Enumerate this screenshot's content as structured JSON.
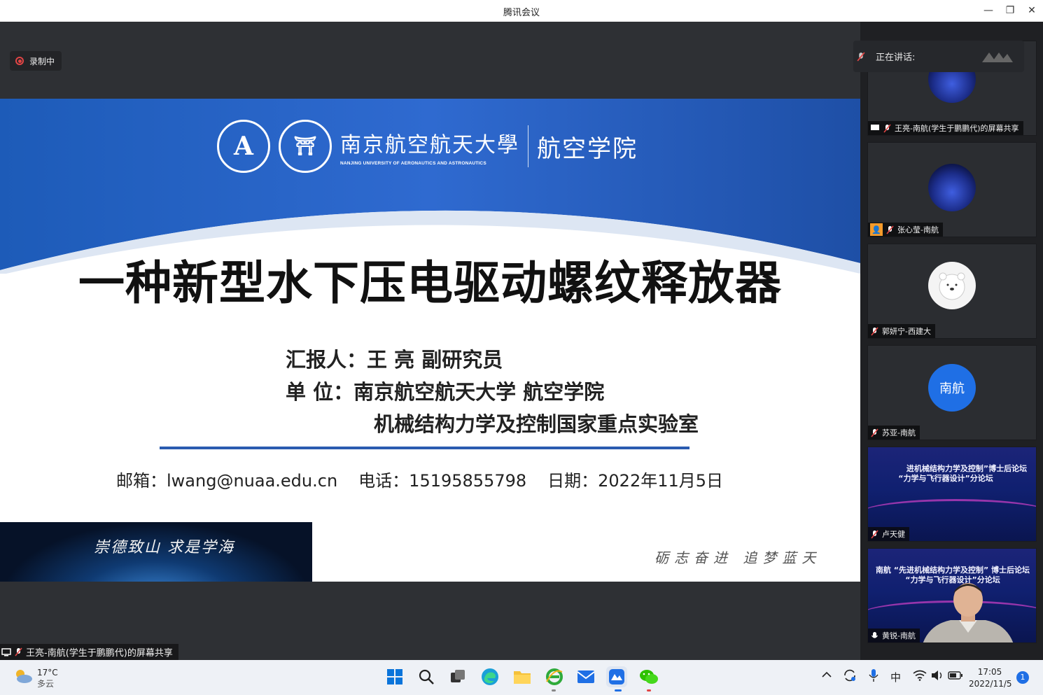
{
  "window": {
    "title": "腾讯会议"
  },
  "recording": {
    "label": "录制中"
  },
  "slide": {
    "university_cn": "南京航空航天大學",
    "university_en": "NANJING UNIVERSITY OF AERONAUTICS AND ASTRONAUTICS",
    "school": "航空学院",
    "title": "一种新型水下压电驱动螺纹释放器",
    "reporter": "汇报人：王  亮  副研究员",
    "unit": "单      位：南京航空航天大学 航空学院",
    "lab": "机械结构力学及控制国家重点实验室",
    "email": "邮箱：lwang@nuaa.edu.cn",
    "phone": "电话：15195855798",
    "date": "日期：2022年11月5日",
    "banner_text": "崇德致山  求是学海",
    "motto": "砺志奋进  追梦蓝天"
  },
  "share_label": "王亮-南航(学生于鹏鹏代)的屏幕共享",
  "speaking": {
    "label": "正在讲话:"
  },
  "participants": [
    {
      "name": "王亮-南航(学生于鹏鹏代)的屏幕共享"
    },
    {
      "name": "张心莹-南航"
    },
    {
      "name": "郭妍宁-西建大"
    },
    {
      "name": "苏亚-南航",
      "avatar_text": "南航"
    },
    {
      "name": "卢天健",
      "poster_line1": "进机械结构力学及控制”博士后论坛",
      "poster_line2": "“力学与飞行器设计”分论坛"
    },
    {
      "name": "黄锐-南航",
      "poster_line1": "南航 “先进机械结构力学及控制” 博士后论坛",
      "poster_line2": "“力学与飞行器设计”分论坛"
    }
  ],
  "taskbar": {
    "weather_temp": "17°C",
    "weather_desc": "多云",
    "ime": "中",
    "time": "17:05",
    "date": "2022/11/5",
    "notification_count": "1"
  },
  "colors": {
    "slide_blue": "#2a5bb0",
    "accent": "#1f6fe5",
    "record_red": "#e14545"
  }
}
